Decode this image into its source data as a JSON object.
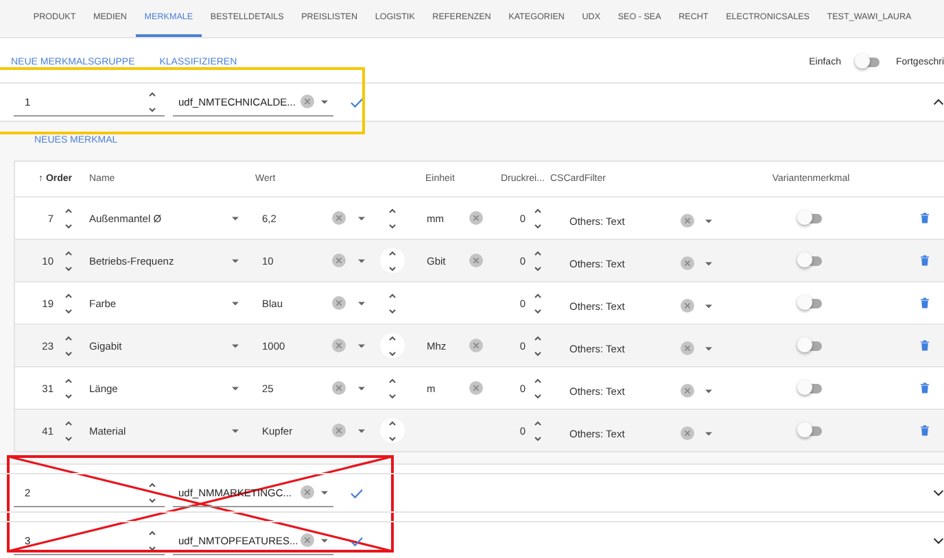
{
  "tabs": [
    {
      "label": "PRODUKT",
      "selected": false
    },
    {
      "label": "MEDIEN",
      "selected": false
    },
    {
      "label": "MERKMALE",
      "selected": true
    },
    {
      "label": "BESTELLDETAILS",
      "selected": false
    },
    {
      "label": "PREISLISTEN",
      "selected": false
    },
    {
      "label": "LOGISTIK",
      "selected": false
    },
    {
      "label": "REFERENZEN",
      "selected": false
    },
    {
      "label": "KATEGORIEN",
      "selected": false
    },
    {
      "label": "UDX",
      "selected": false
    },
    {
      "label": "SEO - SEA",
      "selected": false
    },
    {
      "label": "RECHT",
      "selected": false
    },
    {
      "label": "ELECTRONICSALES",
      "selected": false
    },
    {
      "label": "TEST_WAWI_LAURA",
      "selected": false
    }
  ],
  "actions": [
    "NEUE MERKMALSGRUPPE",
    "KLASSIFIZIEREN"
  ],
  "mode": {
    "left_label": "Einfach",
    "right_label": "Fortgeschri",
    "on": false
  },
  "groups": [
    {
      "order": "1",
      "name": "udf_NMTECHNICALDE...",
      "expanded": true,
      "highlighted": true,
      "crossed_out": false,
      "add_label": "NEUES MERKMAL",
      "columns": [
        "↑ Order",
        "Name",
        "Wert",
        "Einheit",
        "Druckrei...",
        "CSCardFilter",
        "Variantenmerkmal"
      ],
      "rows": [
        {
          "order": "7",
          "name": "Außenmantel Ø",
          "value": "6,2",
          "unit": "mm",
          "print": "0",
          "filter": "Others: Text",
          "variant": false
        },
        {
          "order": "10",
          "name": "Betriebs-Frequenz",
          "value": "10",
          "unit": "Gbit",
          "print": "0",
          "filter": "Others: Text",
          "variant": false
        },
        {
          "order": "19",
          "name": "Farbe",
          "value": "Blau",
          "print": "0",
          "filter": "Others: Text",
          "variant": false
        },
        {
          "order": "23",
          "name": "Gigabit",
          "value": "1000",
          "unit": "Mhz",
          "print": "0",
          "filter": "Others: Text",
          "variant": false
        },
        {
          "order": "31",
          "name": "Länge",
          "value": "25",
          "unit": "m",
          "print": "0",
          "filter": "Others: Text",
          "variant": false
        },
        {
          "order": "41",
          "name": "Material",
          "value": "Kupfer",
          "print": "0",
          "filter": "Others: Text",
          "variant": false
        }
      ]
    },
    {
      "order": "2",
      "name": "udf_NMMARKETINGC...",
      "expanded": false,
      "highlighted": false,
      "crossed_out": true
    },
    {
      "order": "3",
      "name": "udf_NMTOPFEATURES...",
      "expanded": false,
      "highlighted": false,
      "crossed_out": true
    }
  ]
}
